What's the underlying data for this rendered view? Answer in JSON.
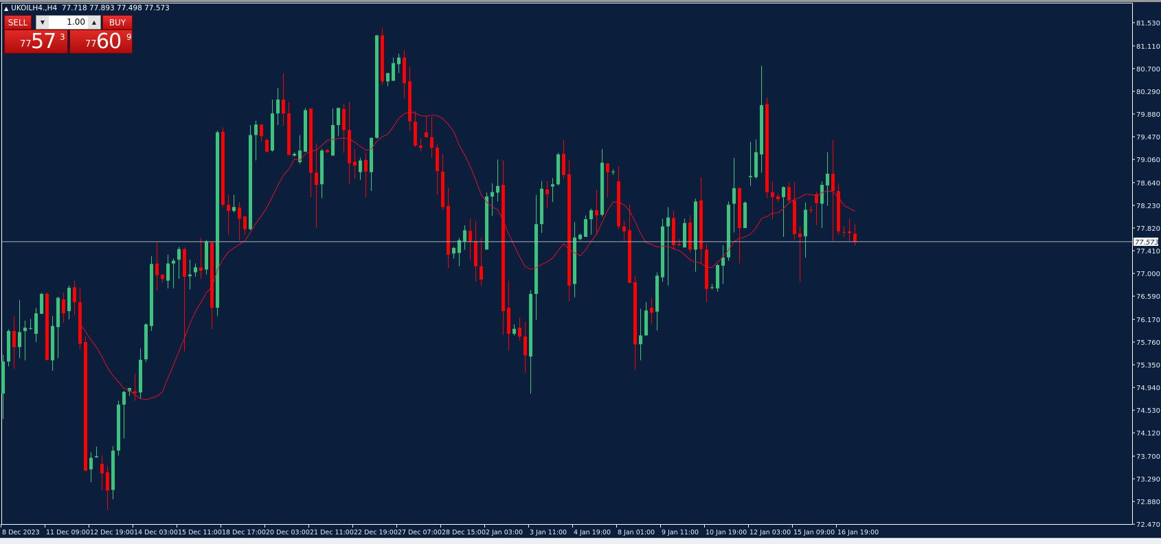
{
  "header": {
    "symbol": "UKOILH4.,H4",
    "ohlc": "77.718 77.893 77.498 77.573"
  },
  "trade_panel": {
    "sell_label": "SELL",
    "buy_label": "BUY",
    "lot_size": "1.00",
    "sell_price": {
      "prefix": "77",
      "big": "57",
      "sup": "3"
    },
    "buy_price": {
      "prefix": "77",
      "big": "60",
      "sup": "9"
    }
  },
  "colors": {
    "background": "#0b1e3b",
    "bull": "#3cc47c",
    "bear": "#ff0000",
    "ma": "#e0102a",
    "axis": "#ffffff"
  },
  "chart_data": {
    "type": "candlestick",
    "title": "UKOILH4.,H4",
    "ylim": [
      72.47,
      81.53
    ],
    "current_price": 77.573,
    "current_price_label": "77.573",
    "ma": {
      "type": "SMA",
      "period": 15
    },
    "y_ticks": [
      "81.530",
      "81.110",
      "80.700",
      "80.290",
      "79.880",
      "79.470",
      "79.060",
      "78.640",
      "78.230",
      "77.820",
      "77.410",
      "77.000",
      "76.590",
      "76.170",
      "75.760",
      "75.350",
      "74.940",
      "74.530",
      "74.120",
      "73.700",
      "73.290",
      "72.880",
      "72.470"
    ],
    "x_ticks": [
      "8 Dec 2023",
      "11 Dec 09:00",
      "12 Dec 19:00",
      "14 Dec 03:00",
      "15 Dec 11:00",
      "18 Dec 17:00",
      "20 Dec 03:00",
      "21 Dec 11:00",
      "22 Dec 19:00",
      "27 Dec 07:00",
      "28 Dec 15:00",
      "2 Jan 03:00",
      "3 Jan 11:00",
      "4 Jan 19:00",
      "8 Jan 01:00",
      "9 Jan 11:00",
      "10 Jan 19:00",
      "12 Jan 03:00",
      "15 Jan 09:00",
      "16 Jan 19:00"
    ],
    "bars_per_x_tick": 8,
    "candles_ohlc": [
      [
        74.83,
        75.53,
        74.37,
        75.41
      ],
      [
        75.41,
        75.99,
        75.32,
        75.96
      ],
      [
        75.96,
        76.23,
        75.28,
        75.67
      ],
      [
        75.67,
        76.52,
        75.47,
        75.94
      ],
      [
        75.96,
        76.15,
        75.43,
        76.02
      ],
      [
        76.0,
        76.18,
        75.98,
        76.01
      ],
      [
        75.91,
        76.38,
        75.76,
        76.28
      ],
      [
        76.27,
        76.65,
        76.27,
        76.63
      ],
      [
        76.63,
        76.65,
        75.43,
        75.44
      ],
      [
        75.43,
        76.23,
        75.24,
        76.05
      ],
      [
        76.03,
        76.58,
        75.47,
        76.56
      ],
      [
        76.53,
        76.65,
        76.11,
        76.28
      ],
      [
        76.32,
        76.78,
        76.17,
        76.74
      ],
      [
        76.75,
        76.87,
        76.25,
        76.48
      ],
      [
        76.48,
        76.73,
        75.63,
        75.73
      ],
      [
        75.76,
        75.86,
        73.42,
        73.44
      ],
      [
        73.46,
        73.77,
        73.23,
        73.67
      ],
      [
        73.68,
        73.87,
        73.67,
        73.7
      ],
      [
        73.56,
        73.71,
        73.09,
        73.39
      ],
      [
        73.41,
        73.52,
        72.72,
        73.08
      ],
      [
        73.09,
        73.88,
        72.92,
        73.8
      ],
      [
        73.8,
        74.7,
        73.71,
        74.63
      ],
      [
        74.63,
        74.88,
        74.02,
        74.86
      ],
      [
        74.87,
        74.93,
        74.79,
        74.93
      ],
      [
        74.87,
        75.19,
        74.7,
        74.84
      ],
      [
        74.85,
        75.65,
        74.74,
        75.44
      ],
      [
        75.45,
        76.1,
        75.4,
        76.08
      ],
      [
        76.05,
        77.31,
        75.96,
        77.17
      ],
      [
        77.18,
        77.56,
        76.69,
        76.97
      ],
      [
        76.98,
        76.98,
        76.83,
        76.9
      ],
      [
        76.87,
        77.34,
        76.73,
        77.18
      ],
      [
        77.18,
        77.27,
        76.73,
        77.23
      ],
      [
        77.25,
        77.48,
        76.9,
        77.44
      ],
      [
        77.44,
        77.47,
        75.59,
        76.94
      ],
      [
        76.95,
        77.25,
        76.71,
        76.98
      ],
      [
        77.02,
        77.18,
        76.94,
        77.11
      ],
      [
        77.11,
        77.64,
        76.91,
        77.05
      ],
      [
        77.07,
        77.6,
        76.98,
        77.58
      ],
      [
        77.56,
        77.57,
        76.0,
        76.38
      ],
      [
        76.38,
        79.58,
        76.23,
        79.55
      ],
      [
        79.56,
        79.64,
        78.2,
        78.24
      ],
      [
        78.24,
        78.42,
        77.7,
        78.13
      ],
      [
        78.13,
        78.42,
        78.1,
        78.2
      ],
      [
        78.19,
        78.29,
        77.6,
        77.99
      ],
      [
        78.03,
        78.03,
        77.7,
        77.8
      ],
      [
        77.8,
        79.68,
        77.78,
        79.5
      ],
      [
        79.5,
        79.76,
        79.04,
        79.69
      ],
      [
        79.69,
        79.69,
        79.38,
        79.48
      ],
      [
        79.41,
        79.44,
        79.18,
        79.2
      ],
      [
        79.22,
        80.14,
        79.2,
        79.89
      ],
      [
        79.89,
        80.35,
        79.68,
        80.14
      ],
      [
        80.14,
        80.61,
        79.67,
        79.89
      ],
      [
        79.89,
        80.1,
        79.13,
        79.14
      ],
      [
        79.13,
        79.19,
        79.11,
        79.16
      ],
      [
        79.01,
        79.5,
        78.98,
        79.22
      ],
      [
        79.2,
        79.99,
        79.19,
        79.95
      ],
      [
        79.98,
        79.98,
        78.38,
        78.82
      ],
      [
        78.82,
        79.35,
        77.82,
        78.6
      ],
      [
        78.61,
        79.25,
        78.36,
        79.22
      ],
      [
        79.23,
        79.25,
        79.18,
        79.19
      ],
      [
        79.13,
        79.98,
        79.12,
        79.68
      ],
      [
        79.68,
        79.99,
        79.48,
        79.99
      ],
      [
        79.97,
        80.06,
        79.18,
        79.59
      ],
      [
        79.59,
        80.1,
        78.62,
        78.99
      ],
      [
        79.02,
        79.25,
        78.71,
        78.95
      ],
      [
        78.83,
        79.09,
        78.69,
        79.04
      ],
      [
        79.05,
        79.18,
        78.37,
        78.84
      ],
      [
        78.83,
        79.45,
        78.49,
        79.45
      ],
      [
        79.45,
        81.31,
        79.44,
        81.3
      ],
      [
        81.3,
        81.44,
        80.41,
        80.47
      ],
      [
        80.47,
        80.62,
        80.38,
        80.62
      ],
      [
        80.48,
        80.9,
        80.48,
        80.8
      ],
      [
        80.78,
        80.97,
        80.62,
        80.9
      ],
      [
        80.9,
        81.04,
        80.17,
        80.44
      ],
      [
        80.47,
        80.74,
        79.58,
        79.75
      ],
      [
        79.74,
        79.93,
        79.29,
        79.31
      ],
      [
        79.31,
        79.44,
        79.21,
        79.27
      ],
      [
        79.55,
        79.85,
        79.46,
        79.46
      ],
      [
        79.46,
        79.83,
        79.09,
        79.27
      ],
      [
        79.27,
        79.33,
        78.42,
        78.85
      ],
      [
        78.84,
        79.15,
        78.14,
        78.2
      ],
      [
        78.22,
        78.55,
        77.1,
        77.34
      ],
      [
        77.36,
        77.48,
        77.27,
        77.46
      ],
      [
        77.37,
        77.64,
        77.13,
        77.6
      ],
      [
        77.58,
        77.87,
        77.43,
        77.78
      ],
      [
        77.77,
        77.99,
        77.25,
        77.58
      ],
      [
        77.58,
        77.95,
        76.85,
        77.13
      ],
      [
        77.13,
        77.64,
        76.78,
        76.89
      ],
      [
        77.43,
        78.46,
        77.43,
        78.39
      ],
      [
        78.39,
        78.63,
        78.04,
        78.47
      ],
      [
        78.46,
        79.06,
        78.3,
        78.58
      ],
      [
        78.6,
        79.04,
        75.89,
        76.32
      ],
      [
        76.38,
        76.87,
        75.61,
        75.91
      ],
      [
        75.91,
        76.08,
        75.88,
        76.0
      ],
      [
        76.02,
        76.21,
        75.79,
        75.86
      ],
      [
        75.86,
        76.13,
        75.21,
        75.52
      ],
      [
        75.5,
        76.7,
        74.83,
        76.63
      ],
      [
        76.63,
        78.42,
        76.16,
        77.89
      ],
      [
        77.89,
        78.67,
        77.73,
        78.53
      ],
      [
        78.52,
        78.67,
        78.17,
        78.43
      ],
      [
        78.57,
        78.72,
        78.29,
        78.61
      ],
      [
        78.61,
        79.18,
        78.59,
        79.15
      ],
      [
        79.16,
        79.41,
        78.71,
        78.78
      ],
      [
        78.79,
        79.05,
        76.5,
        76.78
      ],
      [
        76.81,
        77.93,
        76.57,
        77.65
      ],
      [
        77.62,
        77.72,
        77.6,
        77.7
      ],
      [
        77.66,
        78.05,
        77.66,
        77.98
      ],
      [
        77.98,
        78.17,
        77.7,
        78.14
      ],
      [
        78.14,
        78.51,
        77.7,
        78.05
      ],
      [
        78.06,
        79.25,
        78.03,
        79.0
      ],
      [
        78.99,
        78.99,
        78.37,
        78.83
      ],
      [
        78.83,
        78.88,
        78.78,
        78.84
      ],
      [
        78.66,
        78.94,
        77.8,
        77.85
      ],
      [
        77.85,
        77.95,
        77.58,
        77.76
      ],
      [
        77.78,
        78.25,
        76.83,
        76.83
      ],
      [
        76.84,
        76.96,
        75.26,
        75.72
      ],
      [
        75.72,
        76.36,
        75.43,
        75.88
      ],
      [
        75.88,
        76.48,
        75.88,
        76.33
      ],
      [
        76.38,
        76.56,
        76.09,
        76.29
      ],
      [
        76.31,
        77.02,
        75.97,
        76.96
      ],
      [
        76.93,
        77.99,
        76.85,
        77.85
      ],
      [
        77.85,
        78.2,
        76.78,
        78.01
      ],
      [
        78.0,
        78.13,
        77.43,
        77.51
      ],
      [
        77.53,
        77.62,
        77.49,
        77.51
      ],
      [
        77.47,
        77.99,
        77.47,
        77.91
      ],
      [
        77.92,
        78.05,
        77.37,
        77.43
      ],
      [
        77.43,
        78.35,
        77.03,
        78.3
      ],
      [
        78.32,
        78.74,
        77.18,
        77.44
      ],
      [
        77.43,
        77.53,
        76.48,
        76.72
      ],
      [
        76.74,
        76.81,
        76.71,
        76.75
      ],
      [
        76.73,
        77.17,
        76.67,
        77.15
      ],
      [
        77.14,
        77.51,
        76.81,
        77.29
      ],
      [
        77.29,
        78.3,
        77.23,
        78.24
      ],
      [
        78.26,
        79.09,
        77.74,
        78.54
      ],
      [
        78.54,
        78.56,
        77.18,
        77.82
      ],
      [
        77.82,
        78.3,
        77.82,
        78.28
      ],
      [
        78.74,
        79.38,
        78.58,
        78.76
      ],
      [
        78.74,
        79.42,
        78.71,
        79.19
      ],
      [
        79.15,
        80.75,
        78.82,
        80.04
      ],
      [
        80.06,
        80.18,
        78.36,
        78.47
      ],
      [
        78.47,
        78.66,
        77.98,
        78.38
      ],
      [
        78.39,
        78.44,
        78.29,
        78.34
      ],
      [
        78.38,
        78.57,
        77.66,
        78.56
      ],
      [
        78.56,
        78.65,
        78.26,
        78.32
      ],
      [
        78.32,
        78.65,
        77.62,
        77.71
      ],
      [
        77.72,
        77.85,
        76.85,
        77.66
      ],
      [
        77.67,
        78.28,
        77.29,
        78.15
      ],
      [
        78.15,
        78.22,
        78.09,
        78.14
      ],
      [
        78.43,
        78.47,
        77.87,
        78.27
      ],
      [
        78.26,
        78.66,
        77.82,
        78.6
      ],
      [
        78.59,
        79.19,
        78.22,
        78.8
      ],
      [
        78.8,
        79.41,
        77.59,
        78.49
      ],
      [
        78.49,
        78.63,
        77.7,
        77.76
      ],
      [
        77.75,
        77.85,
        77.66,
        77.74
      ],
      [
        77.76,
        77.98,
        77.58,
        77.73
      ],
      [
        77.718,
        77.893,
        77.498,
        77.573
      ]
    ]
  }
}
